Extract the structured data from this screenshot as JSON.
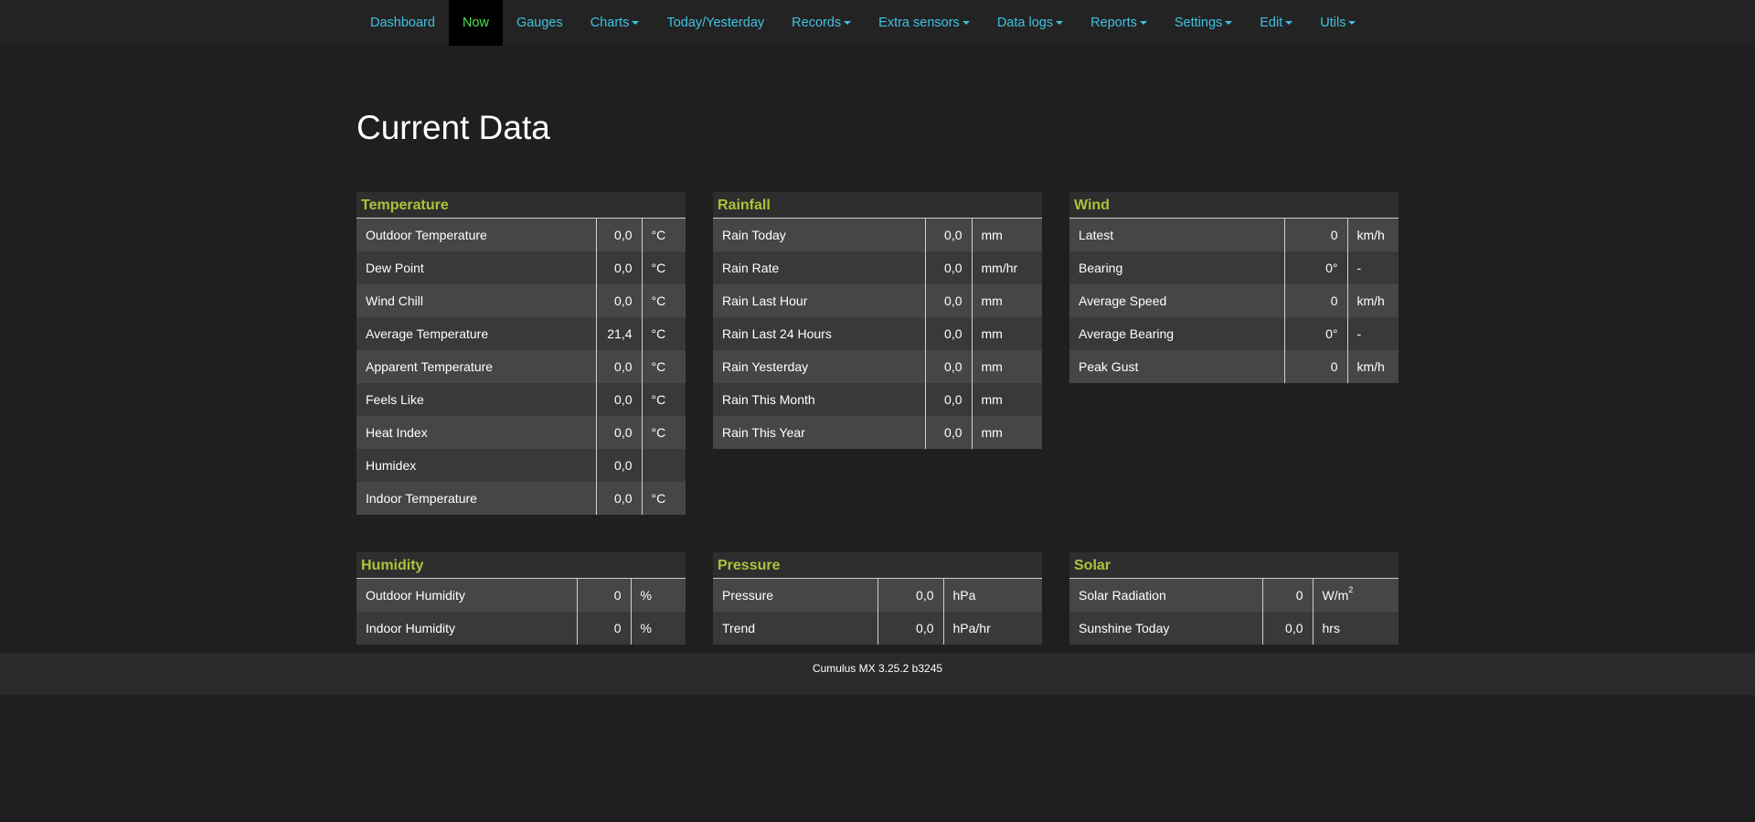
{
  "nav": {
    "items": [
      {
        "label": "Dashboard"
      },
      {
        "label": "Now"
      },
      {
        "label": "Gauges"
      },
      {
        "label": "Charts"
      },
      {
        "label": "Today/Yesterday"
      },
      {
        "label": "Records"
      },
      {
        "label": "Extra sensors"
      },
      {
        "label": "Data logs"
      },
      {
        "label": "Reports"
      },
      {
        "label": "Settings"
      },
      {
        "label": "Edit"
      },
      {
        "label": "Utils"
      }
    ],
    "active": "Now",
    "active_color": "#51e051",
    "link_color": "#3fc2e0"
  },
  "page_title": "Current Data",
  "panels": {
    "temperature": {
      "title": "Temperature",
      "rows": [
        {
          "label": "Outdoor Temperature",
          "value": "0,0",
          "unit": "°C"
        },
        {
          "label": "Dew Point",
          "value": "0,0",
          "unit": "°C"
        },
        {
          "label": "Wind Chill",
          "value": "0,0",
          "unit": "°C"
        },
        {
          "label": "Average Temperature",
          "value": "21,4",
          "unit": "°C"
        },
        {
          "label": "Apparent Temperature",
          "value": "0,0",
          "unit": "°C"
        },
        {
          "label": "Feels Like",
          "value": "0,0",
          "unit": "°C"
        },
        {
          "label": "Heat Index",
          "value": "0,0",
          "unit": "°C"
        },
        {
          "label": "Humidex",
          "value": "0,0",
          "unit": ""
        },
        {
          "label": "Indoor Temperature",
          "value": "0,0",
          "unit": "°C"
        }
      ]
    },
    "rainfall": {
      "title": "Rainfall",
      "rows": [
        {
          "label": "Rain Today",
          "value": "0,0",
          "unit": "mm"
        },
        {
          "label": "Rain Rate",
          "value": "0,0",
          "unit": "mm/hr"
        },
        {
          "label": "Rain Last Hour",
          "value": "0,0",
          "unit": "mm"
        },
        {
          "label": "Rain Last 24 Hours",
          "value": "0,0",
          "unit": "mm"
        },
        {
          "label": "Rain Yesterday",
          "value": "0,0",
          "unit": "mm"
        },
        {
          "label": "Rain This Month",
          "value": "0,0",
          "unit": "mm"
        },
        {
          "label": "Rain This Year",
          "value": "0,0",
          "unit": "mm"
        }
      ]
    },
    "wind": {
      "title": "Wind",
      "rows": [
        {
          "label": "Latest",
          "value": "0",
          "unit": "km/h"
        },
        {
          "label": "Bearing",
          "value": "0°",
          "unit": "-"
        },
        {
          "label": "Average Speed",
          "value": "0",
          "unit": "km/h"
        },
        {
          "label": "Average Bearing",
          "value": "0°",
          "unit": "-"
        },
        {
          "label": "Peak Gust",
          "value": "0",
          "unit": "km/h"
        }
      ]
    },
    "humidity": {
      "title": "Humidity",
      "rows": [
        {
          "label": "Outdoor Humidity",
          "value": "0",
          "unit": "%"
        },
        {
          "label": "Indoor Humidity",
          "value": "0",
          "unit": "%"
        }
      ]
    },
    "pressure": {
      "title": "Pressure",
      "rows": [
        {
          "label": "Pressure",
          "value": "0,0",
          "unit": "hPa"
        },
        {
          "label": "Trend",
          "value": "0,0",
          "unit": "hPa/hr"
        }
      ]
    },
    "solar": {
      "title": "Solar",
      "rows": [
        {
          "label": "Solar Radiation",
          "value": "0",
          "unit": "W/m",
          "unit_sup": "2"
        },
        {
          "label": "Sunshine Today",
          "value": "0,0",
          "unit": "hrs"
        }
      ]
    }
  },
  "footer": {
    "text": "Cumulus MX 3.25.2 b3245"
  },
  "colors": {
    "accent_heading": "#a9c43a",
    "background": "#1f1f1f"
  }
}
